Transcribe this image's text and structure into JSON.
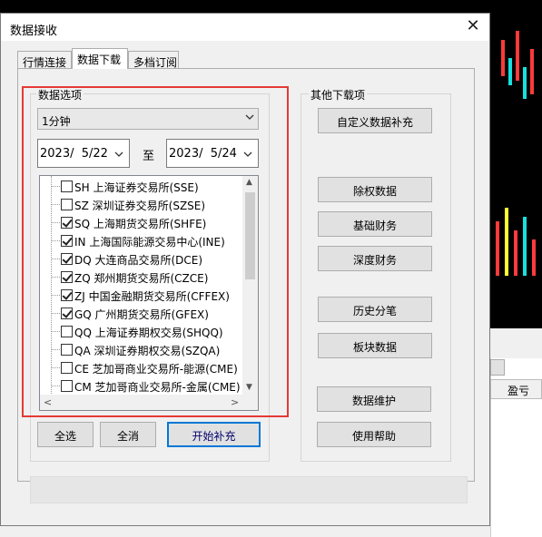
{
  "dialog": {
    "title": "数据接收",
    "close_glyph": "✕"
  },
  "tabs": [
    {
      "label": "行情连接",
      "active": false
    },
    {
      "label": "数据下载",
      "active": true
    },
    {
      "label": "多档订阅",
      "active": false
    }
  ],
  "data_options": {
    "group_label": "数据选项",
    "period": "1分钟",
    "start_date": "2023/  5/22",
    "to_label": "至",
    "end_date": "2023/  5/24",
    "markets": [
      {
        "label": "SH 上海证券交易所(SSE)",
        "checked": false
      },
      {
        "label": "SZ 深圳证券交易所(SZSE)",
        "checked": false
      },
      {
        "label": "SQ 上海期货交易所(SHFE)",
        "checked": true
      },
      {
        "label": "IN 上海国际能源交易中心(INE)",
        "checked": true
      },
      {
        "label": "DQ 大连商品交易所(DCE)",
        "checked": true
      },
      {
        "label": "ZQ 郑州期货交易所(CZCE)",
        "checked": true
      },
      {
        "label": "ZJ 中国金融期货交易所(CFFEX)",
        "checked": true
      },
      {
        "label": "GQ 广州期货交易所(GFEX)",
        "checked": true
      },
      {
        "label": "QQ 上海证券期权交易(SHQQ)",
        "checked": false
      },
      {
        "label": "QA 深圳证券期权交易(SZQA)",
        "checked": false
      },
      {
        "label": "CE 芝加哥商业交易所-能源(CME)",
        "checked": false
      },
      {
        "label": "CM 芝加哥商业交易所-金属(CME)",
        "checked": false
      }
    ],
    "select_all_label": "全选",
    "clear_all_label": "全消",
    "start_fill_label": "开始补充"
  },
  "other_downloads": {
    "group_label": "其他下载项",
    "buttons": {
      "custom_fill": "自定义数据补充",
      "ex_rights": "除权数据",
      "basic_finance": "基础财务",
      "deep_finance": "深度财务",
      "tick_history": "历史分笔",
      "sector_data": "板块数据",
      "data_maintenance": "数据维护",
      "help": "使用帮助"
    }
  },
  "background": {
    "profit_header": "盈亏"
  },
  "colors": {
    "highlight_border": "#e53935",
    "primary_button_border": "#0078d7"
  }
}
